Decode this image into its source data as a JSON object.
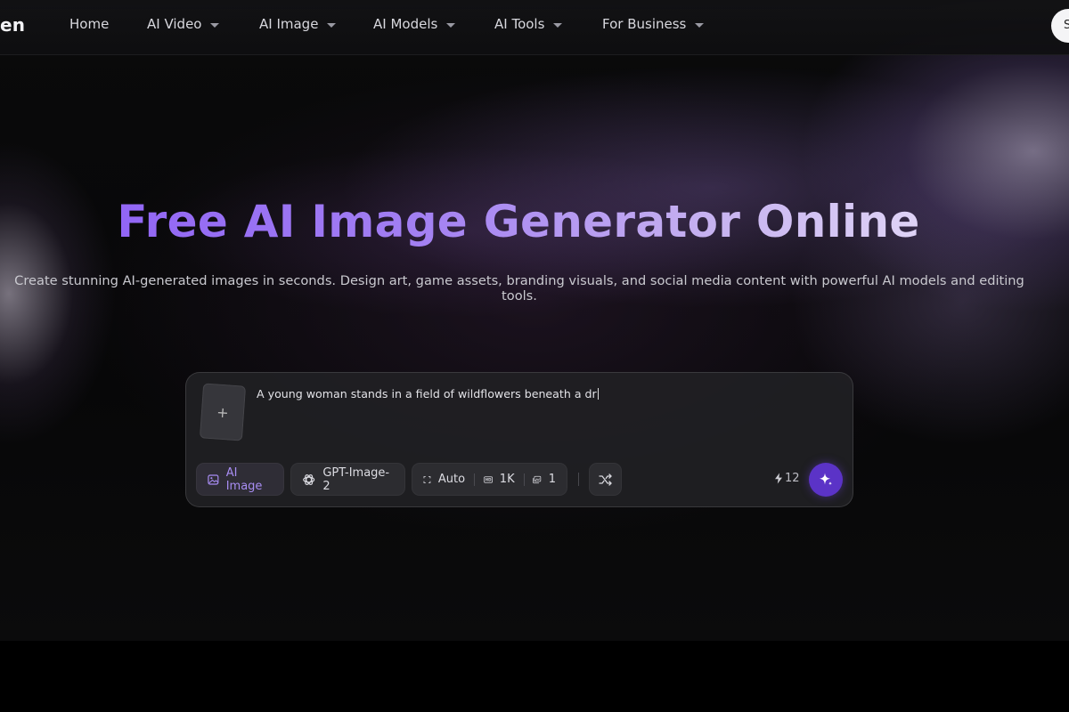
{
  "nav": {
    "brand_fragment": "en",
    "items": [
      {
        "label": "Home",
        "has_caret": false
      },
      {
        "label": "AI Video",
        "has_caret": true
      },
      {
        "label": "AI Image",
        "has_caret": true
      },
      {
        "label": "AI Models",
        "has_caret": true
      },
      {
        "label": "AI Tools",
        "has_caret": true
      },
      {
        "label": "For Business",
        "has_caret": true
      }
    ],
    "signin_fragment": "S"
  },
  "hero": {
    "title": "Free AI Image Generator Online",
    "subtitle": "Create stunning AI-generated images in seconds. Design art, game assets, branding visuals, and social media content with powerful AI models and editing tools."
  },
  "composer": {
    "upload_glyph": "+",
    "prompt_value": "A young woman stands in a field of wildflowers beneath a dr",
    "mode_label": "AI Image",
    "model_label": "GPT-Image-2",
    "ratio_label": "Auto",
    "resolution_label": "1K",
    "count_label": "1",
    "credits": "12"
  },
  "colors": {
    "accent": "#8b5cf6",
    "generate_button": "#5b33c7",
    "background": "#000000"
  },
  "icons": [
    "caret-down-icon",
    "plus-icon",
    "image-icon",
    "openai-icon",
    "aspect-ratio-icon",
    "hd-icon",
    "images-icon",
    "shuffle-icon",
    "lightning-icon",
    "sparkle-icon"
  ]
}
